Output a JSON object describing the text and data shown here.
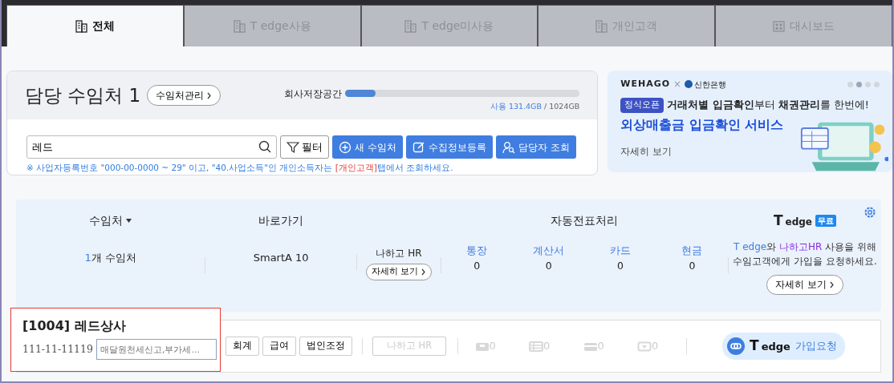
{
  "tabs": [
    {
      "label": "전체",
      "kind": "building",
      "selected": true
    },
    {
      "label": "T edge사용",
      "kind": "building",
      "selected": false
    },
    {
      "label": "T edge미사용",
      "kind": "building",
      "selected": false
    },
    {
      "label": "개인고객",
      "kind": "building",
      "selected": false
    },
    {
      "label": "대시보드",
      "kind": "grid",
      "selected": false
    }
  ],
  "summary": {
    "title": "담당 수임처 1",
    "manage_button": "수임처관리",
    "storage": {
      "label": "회사저장공간",
      "level": 0.13,
      "used": "사용 131.4GB",
      "total": "/ 1024GB"
    },
    "search": {
      "value": "레드"
    },
    "filter_button": "필터",
    "actions": [
      {
        "label": "새 수임처",
        "kind": "plus"
      },
      {
        "label": "수집정보등록",
        "kind": "edit"
      },
      {
        "label": "담당자 조회",
        "kind": "person"
      }
    ],
    "notice": {
      "before": "※ 사업자등록번호 \"000-00-0000 ~ 29\" 이고, \"40.사업소득\"인 개인소득자는 ",
      "highlight": "[개인고객]",
      "after": "탭에서 조회하세요."
    }
  },
  "banner": {
    "brand": "WEHAGO",
    "separator": "×",
    "partner": "신한은행",
    "badge": "정식오픈",
    "headline": "**거래처별 입금확인**부터 **채권관리**를 한번에!",
    "title": "외상매출금 입금확인 서비스",
    "link": "자세히 보기",
    "dots": [
      {
        "selected": false
      },
      {
        "selected": true
      },
      {
        "selected": false
      },
      {
        "selected": false
      }
    ]
  },
  "overview": {
    "headers": {
      "clients": "수임처",
      "shortcuts": "바로가기",
      "auto": "자동전표처리"
    },
    "tedge": {
      "logo_t": "T",
      "logo_edge": "edge",
      "badge": "무료",
      "message": [
        {
          "text": "T edge",
          "kind": "blue"
        },
        {
          "text": "와 ",
          "kind": "plain"
        },
        {
          "text": "나하고HR",
          "kind": "purple"
        },
        {
          "text": " 사용을 위해 수임고객에게 가입을 요청하세요.",
          "kind": "plain"
        }
      ],
      "button": "자세히 보기"
    },
    "count": "1",
    "count_label": "개 수임처",
    "shortcut": "SmartA 10",
    "hr_label": "나하고 HR",
    "hr_button": "자세히 보기",
    "auto_items": [
      {
        "label": "통장",
        "value": "0"
      },
      {
        "label": "계산서",
        "value": "0"
      },
      {
        "label": "카드",
        "value": "0"
      },
      {
        "label": "현금",
        "value": "0"
      }
    ]
  },
  "clients": [
    {
      "name": "[1004] 레드상사",
      "biz_no": "111-11-11119",
      "memo": "매달원천세신고,부가세...",
      "highlighted": true,
      "buttons": [
        {
          "label": "회계",
          "disabled": false
        },
        {
          "label": "급여",
          "disabled": false
        },
        {
          "label": "법인조정",
          "disabled": false
        },
        {
          "label": "나하고 HR",
          "disabled": true
        }
      ],
      "counts": [
        {
          "kind": "device",
          "value": "0"
        },
        {
          "kind": "table",
          "value": "0"
        },
        {
          "kind": "card",
          "value": "0"
        },
        {
          "kind": "cash",
          "value": "0"
        }
      ],
      "join": {
        "logo_t": "T",
        "logo_edge": "edge",
        "label": "가입요청"
      }
    }
  ]
}
